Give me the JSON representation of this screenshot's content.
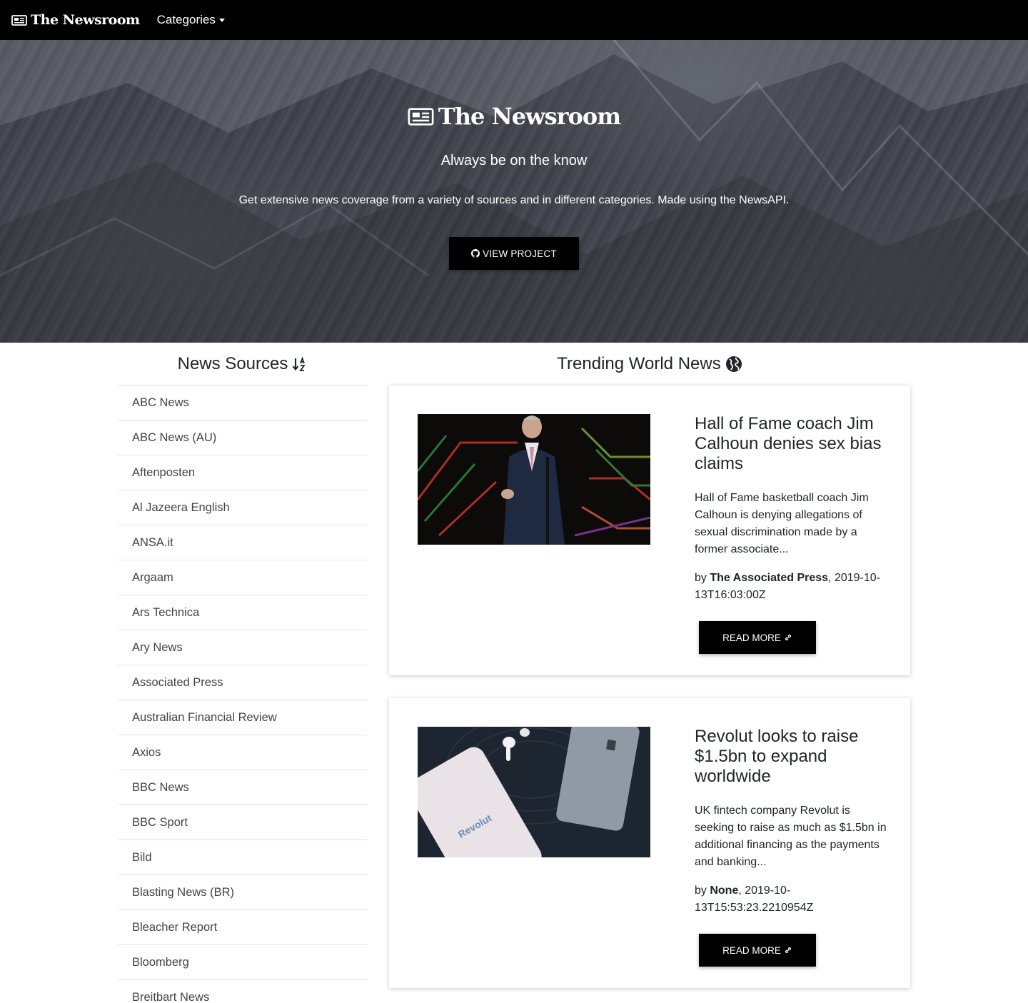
{
  "navbar": {
    "brand": "The Newsroom",
    "categories_label": "Categories"
  },
  "hero": {
    "title": "The Newsroom",
    "tagline": "Always be on the know",
    "description": "Get extensive news coverage from a variety of sources and in different categories. Made using the NewsAPI.",
    "button_label": "VIEW PROJECT"
  },
  "sources": {
    "heading": "News Sources",
    "items": [
      "ABC News",
      "ABC News (AU)",
      "Aftenposten",
      "Al Jazeera English",
      "ANSA.it",
      "Argaam",
      "Ars Technica",
      "Ary News",
      "Associated Press",
      "Australian Financial Review",
      "Axios",
      "BBC News",
      "BBC Sport",
      "Bild",
      "Blasting News (BR)",
      "Bleacher Report",
      "Bloomberg",
      "Breitbart News"
    ]
  },
  "news": {
    "heading": "Trending World News",
    "articles": [
      {
        "title": "Hall of Fame coach Jim Calhoun denies sex bias claims",
        "description": "Hall of Fame basketball coach Jim Calhoun is denying allegations of sexual discrimination made by a former associate...",
        "by_label": "by",
        "author": "The Associated Press",
        "published": ", 2019-10-13T16:03:00Z",
        "button_label": "READ MORE"
      },
      {
        "title": "Revolut looks to raise $1.5bn to expand worldwide",
        "description": "UK fintech company Revolut is seeking to raise as much as $1.5bn in additional financing as the payments and banking...",
        "by_label": "by",
        "author": "None",
        "published": ", 2019-10-13T15:53:23.2210954Z",
        "button_label": "READ MORE",
        "image_text": "Revolut"
      }
    ]
  }
}
